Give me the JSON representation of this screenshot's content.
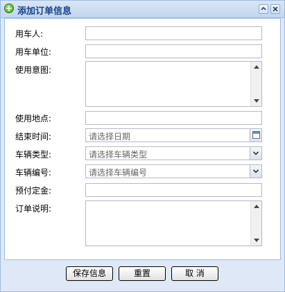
{
  "dialog": {
    "title": "添加订单信息"
  },
  "form": {
    "user_label": "用车人:",
    "unit_label": "用车单位:",
    "purpose_label": "使用意图:",
    "location_label": "使用地点:",
    "end_time_label": "结束时间:",
    "end_time_placeholder": "请选择日期",
    "vehicle_type_label": "车辆类型:",
    "vehicle_type_placeholder": "请选择车辆类型",
    "vehicle_no_label": "车辆编号:",
    "vehicle_no_placeholder": "请选择车辆编号",
    "deposit_label": "预付定金:",
    "note_label": "订单说明:"
  },
  "buttons": {
    "save": "保存信息",
    "reset": "重置",
    "cancel": "取 消"
  },
  "colors": {
    "window_border": "#99bbe8",
    "window_bg": "#dfe8f6",
    "title_text": "#15428b"
  }
}
